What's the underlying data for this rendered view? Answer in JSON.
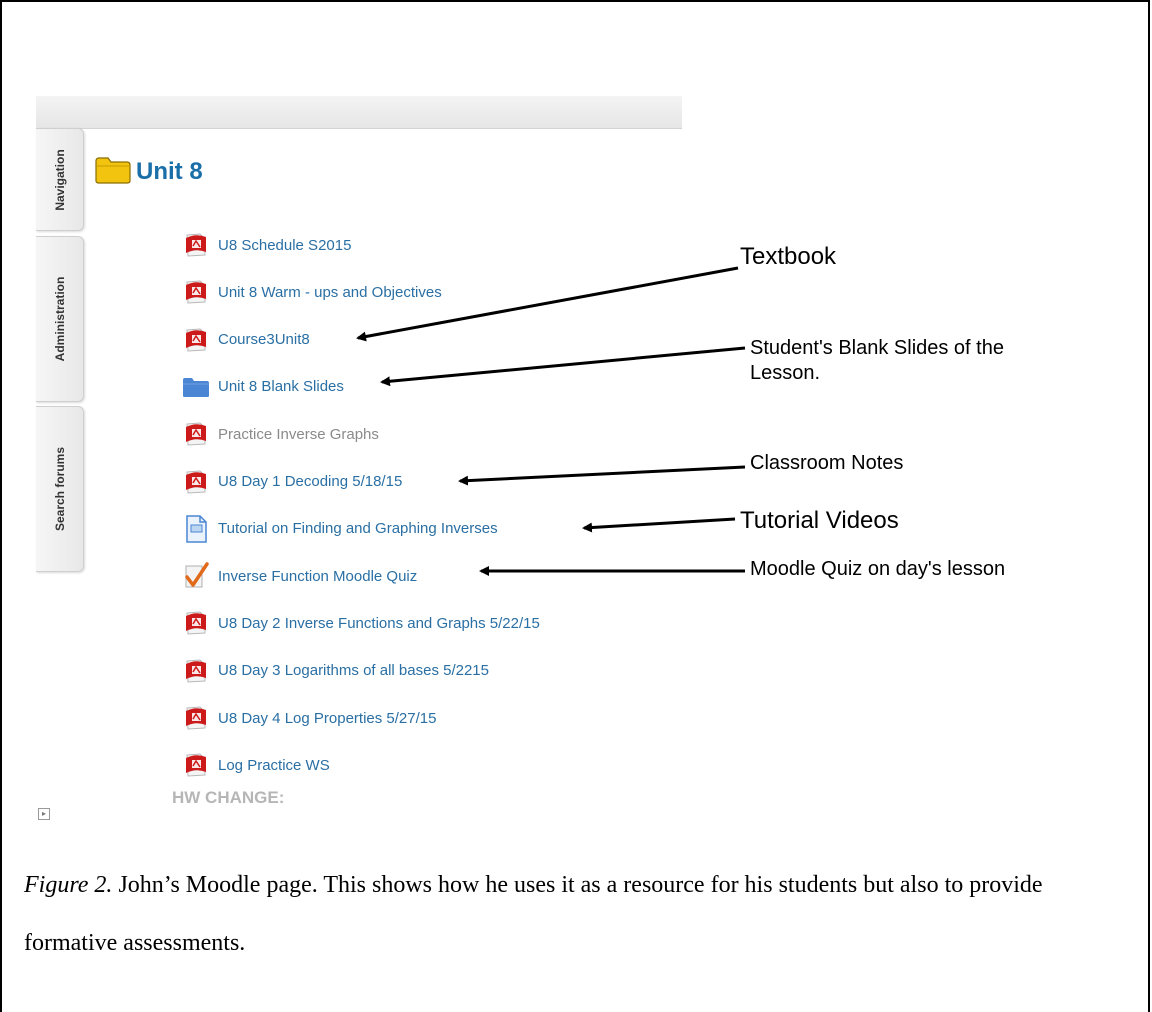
{
  "sidebar": {
    "tabs": [
      {
        "label": "Navigation"
      },
      {
        "label": "Administration"
      },
      {
        "label": "Search forums"
      }
    ]
  },
  "section": {
    "title": "Unit 8"
  },
  "items": [
    {
      "label": "U8 Schedule S2015",
      "icon": "pdf-icon"
    },
    {
      "label": "Unit 8 Warm - ups and Objectives",
      "icon": "pdf-icon"
    },
    {
      "label": "Course3Unit8",
      "icon": "pdf-icon"
    },
    {
      "label": "Unit 8 Blank Slides",
      "icon": "folder-icon"
    },
    {
      "label": "Practice Inverse Graphs",
      "icon": "pdf-icon",
      "dimmed": true
    },
    {
      "label": "U8 Day 1 Decoding 5/18/15",
      "icon": "pdf-icon"
    },
    {
      "label": "Tutorial on Finding and Graphing Inverses",
      "icon": "page-icon"
    },
    {
      "label": "Inverse Function Moodle Quiz",
      "icon": "quiz-checkmark-icon"
    },
    {
      "label": "U8 Day 2 Inverse Functions and Graphs 5/22/15",
      "icon": "pdf-icon"
    },
    {
      "label": "U8 Day 3 Logarithms of all bases 5/2215",
      "icon": "pdf-icon"
    },
    {
      "label": "U8 Day 4 Log Properties 5/27/15",
      "icon": "pdf-icon"
    },
    {
      "label": "Log Practice WS",
      "icon": "pdf-icon"
    }
  ],
  "hw_change": "HW CHANGE:",
  "annotations": {
    "textbook": "Textbook",
    "blank_slides_line1": "Student's Blank Slides of the",
    "blank_slides_line2": "Lesson.",
    "classroom_notes": "Classroom Notes",
    "tutorial_videos": "Tutorial Videos",
    "moodle_quiz": "Moodle Quiz on day's lesson"
  },
  "caption": {
    "label": "Figure 2.",
    "text": " John’s Moodle page. This shows how he uses it as a resource for his students but also to provide formative assessments."
  },
  "colors": {
    "link": "#2a6fa4",
    "title": "#1a6fa8",
    "pdf_red": "#cc1a1a",
    "folder_yellow": "#f2c40f",
    "folder_blue": "#4a86d4",
    "quiz_orange": "#e06a1a"
  }
}
